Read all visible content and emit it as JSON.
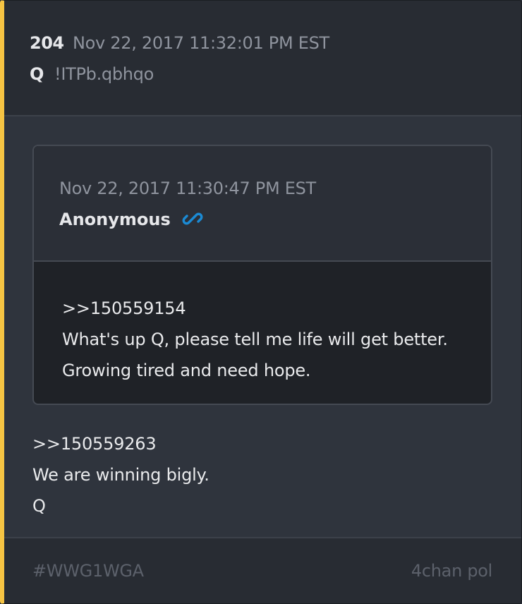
{
  "post": {
    "number": "204",
    "date": "Nov 22, 2017 11:32:01 PM EST",
    "author": "Q",
    "tripcode": "!ITPb.qbhqo",
    "body": [
      ">>150559263",
      "We are winning bigly.",
      "Q"
    ]
  },
  "quoted_post": {
    "date": "Nov 22, 2017 11:30:47 PM EST",
    "author": "Anonymous",
    "link_icon": "link-icon",
    "body": [
      ">>150559154",
      "What's up Q, please tell me life will get better.",
      "Growing tired and need hope."
    ]
  },
  "footer": {
    "hashtag": "#WWG1WGA",
    "source": "4chan pol"
  },
  "colors": {
    "accent_bar": "#f6c443",
    "link_icon": "#1b8ad3",
    "background": "#2f343d"
  }
}
